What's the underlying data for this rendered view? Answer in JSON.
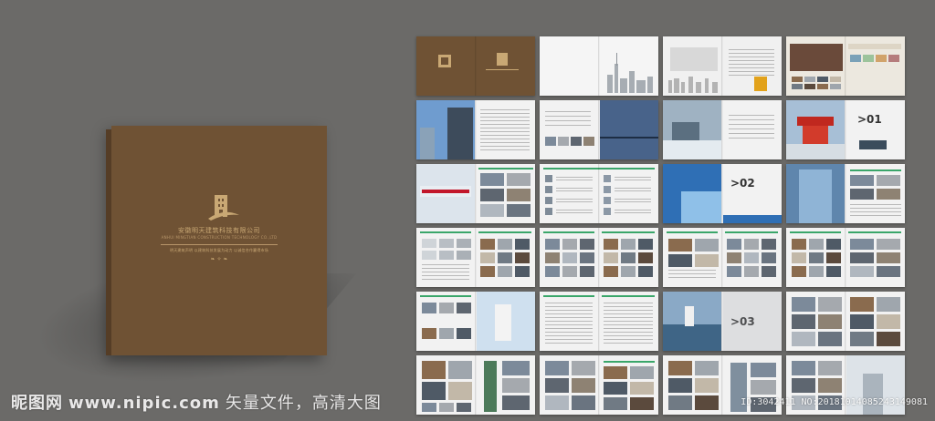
{
  "cover": {
    "company_name": "安徽明天建筑科技有限公司",
    "company_name_en": "ANHUI MINGTIAN CONSTRUCTION TECHNOLOGY CO.,LTD",
    "slogan": "明天建筑声明    以建筑科技发展为动力    以诚信合作赢得市场",
    "ornament": "❧ ✧ ❧"
  },
  "pages": [
    {
      "kind": "brown-cover"
    },
    {
      "kind": "city"
    },
    {
      "kind": "world-map"
    },
    {
      "kind": "collage"
    },
    {
      "kind": "sky"
    },
    {
      "kind": "bridge"
    },
    {
      "kind": "mountain"
    },
    {
      "kind": "pavilion",
      "num": ">01"
    },
    {
      "kind": "train"
    },
    {
      "kind": "list"
    },
    {
      "kind": "wave",
      "num": ">02"
    },
    {
      "kind": "glass"
    },
    {
      "kind": "table"
    },
    {
      "kind": "thumbs"
    },
    {
      "kind": "thumbs2"
    },
    {
      "kind": "thumbs3"
    },
    {
      "kind": "robot"
    },
    {
      "kind": "text"
    },
    {
      "kind": "boat",
      "num": ">03"
    },
    {
      "kind": "photos"
    },
    {
      "kind": "buildings"
    },
    {
      "kind": "buildings2"
    },
    {
      "kind": "buildings3"
    },
    {
      "kind": "tower"
    }
  ],
  "watermark": {
    "brand": "昵图网",
    "url": "www.nipic.com",
    "suffix": "矢量文件，高清大图",
    "id": "ID:3042411 NO:20181014085243149081"
  },
  "colors": {
    "background": "#6b6a68",
    "cover_brown": "#6f5234",
    "gold": "#c9a874",
    "accent_green": "#3aa66a",
    "accent_blue": "#2f6fb5"
  }
}
